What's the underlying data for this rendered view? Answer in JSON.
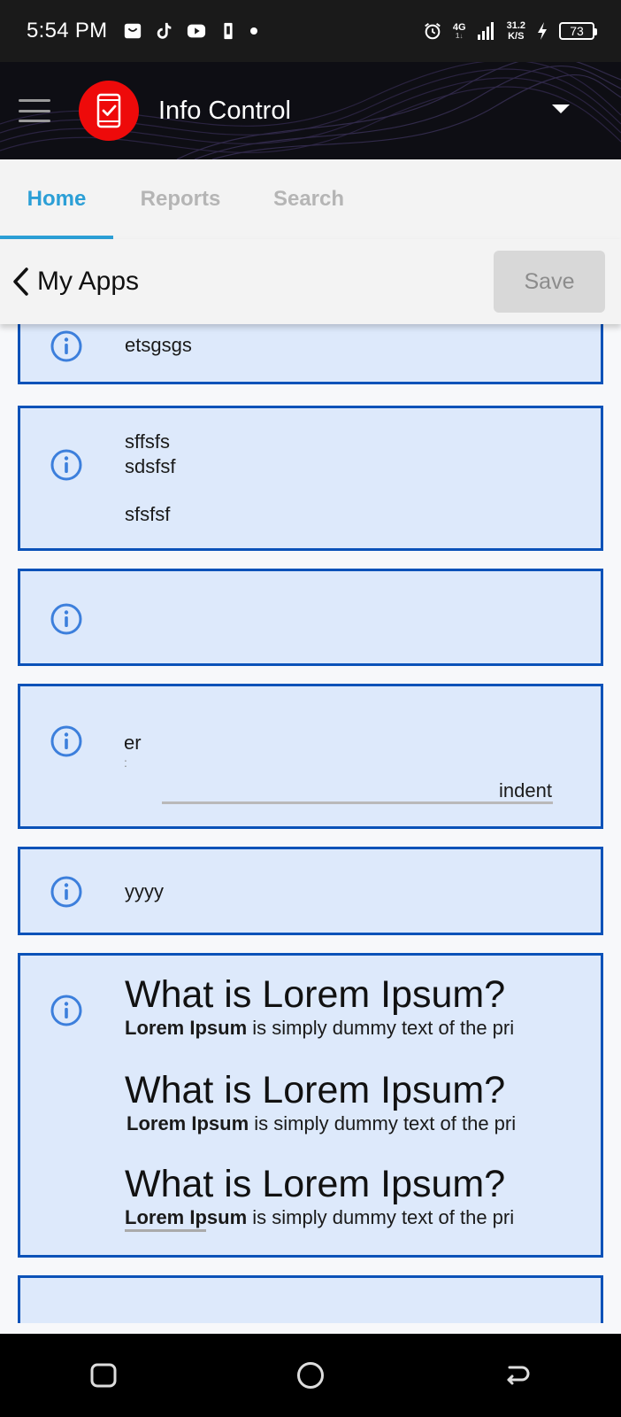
{
  "status_bar": {
    "time": "5:54 PM",
    "network": "4G",
    "network_sub": "1↓",
    "speed_value": "31.2",
    "speed_unit": "K/S",
    "battery": "73"
  },
  "header": {
    "title": "Info Control",
    "logo_icon": "phone-check-icon",
    "menu_icon": "hamburger-icon",
    "dropdown_icon": "caret-down-icon",
    "logo_color": "#ee0a0a"
  },
  "tabs": [
    {
      "label": "Home",
      "active": true
    },
    {
      "label": "Reports",
      "active": false
    },
    {
      "label": "Search",
      "active": false
    }
  ],
  "nav": {
    "back_label": "My Apps",
    "save_label": "Save"
  },
  "cards": [
    {
      "lines": [
        "etsgsgs"
      ]
    },
    {
      "lines": [
        "sffsfs",
        "sdsfsf",
        "",
        "sfsfsf"
      ]
    },
    {
      "lines": []
    },
    {
      "lines": [
        "er",
        ":",
        "indent"
      ]
    },
    {
      "lines": [
        "yyyy"
      ]
    },
    {
      "blocks": [
        {
          "heading": "What is Lorem Ipsum?",
          "bold": "Lorem Ipsum",
          "rest": " is simply dummy text of the pri"
        },
        {
          "heading": "What is Lorem Ipsum?",
          "bold": "Lorem Ipsum",
          "rest": " is simply dummy text of the pri"
        },
        {
          "heading": "What is Lorem Ipsum?",
          "bold": "Lorem Ipsum",
          "rest": " is simply dummy text of the pri"
        }
      ]
    }
  ],
  "colors": {
    "accent": "#2c9fd6",
    "card_border": "#0b52b8",
    "card_bg": "#dde9fb",
    "info_icon": "#3c7fdc"
  }
}
